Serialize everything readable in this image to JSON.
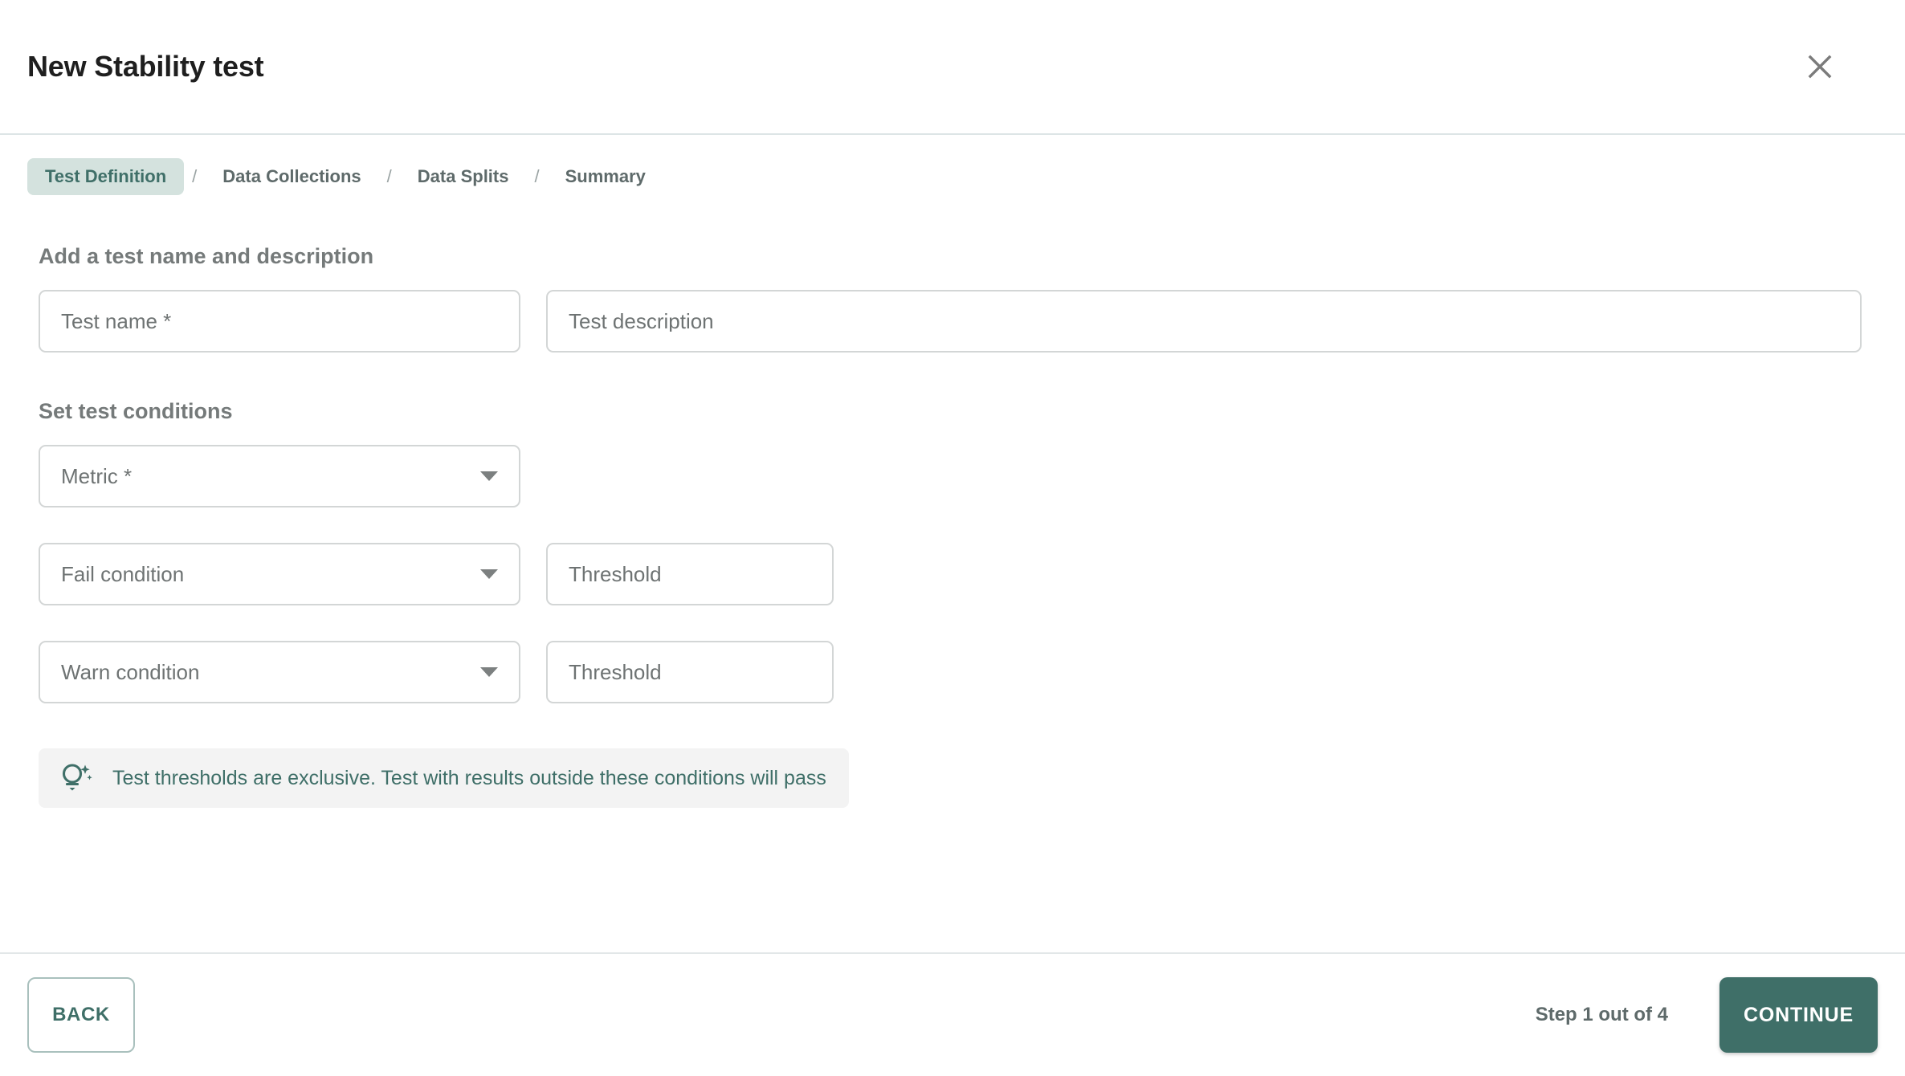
{
  "header": {
    "title": "New Stability test",
    "close_icon": "close-icon"
  },
  "breadcrumbs": {
    "separator": "/",
    "items": [
      {
        "label": "Test Definition",
        "active": true
      },
      {
        "label": "Data Collections",
        "active": false
      },
      {
        "label": "Data Splits",
        "active": false
      },
      {
        "label": "Summary",
        "active": false
      }
    ]
  },
  "sections": {
    "definition": {
      "title": "Add a test name and description",
      "test_name": {
        "placeholder": "Test name *",
        "value": ""
      },
      "test_description": {
        "placeholder": "Test description",
        "value": ""
      }
    },
    "conditions": {
      "title": "Set test conditions",
      "metric": {
        "placeholder": "Metric *",
        "value": "",
        "icon": "chevron-down-icon"
      },
      "fail": {
        "condition": {
          "placeholder": "Fail condition",
          "value": "",
          "icon": "chevron-down-icon"
        },
        "threshold": {
          "placeholder": "Threshold",
          "value": ""
        }
      },
      "warn": {
        "condition": {
          "placeholder": "Warn condition",
          "value": "",
          "icon": "chevron-down-icon"
        },
        "threshold": {
          "placeholder": "Threshold",
          "value": ""
        }
      }
    }
  },
  "tip": {
    "icon": "lightbulb-icon",
    "text": "Test thresholds are exclusive. Test with results outside these conditions will pass"
  },
  "footer": {
    "back_label": "BACK",
    "step_label": "Step 1 out of 4",
    "continue_label": "CONTINUE"
  },
  "colors": {
    "accent_teal": "#3f6f68",
    "accent_teal_light": "#d4e2de",
    "border_grey": "#d3d6d6",
    "text_grey": "#757a7a",
    "tip_bg": "#f3f3f3"
  }
}
